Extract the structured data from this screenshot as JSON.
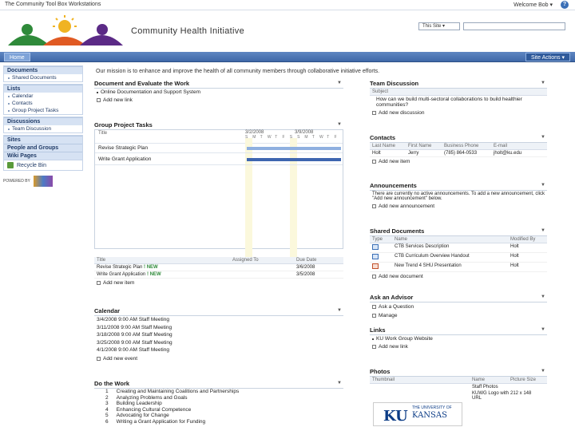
{
  "topbar": {
    "crumb": "The Community Tool Box Workstations",
    "welcome": "Welcome Bob ▾",
    "help": "?"
  },
  "header": {
    "site_title": "Community Health Initiative",
    "scope": "This Site ▾",
    "search_placeholder": ""
  },
  "nav": {
    "home": "Home",
    "site_actions": "Site Actions ▾"
  },
  "quicklaunch": {
    "documents": {
      "head": "Documents",
      "items": [
        "Shared Documents"
      ]
    },
    "lists": {
      "head": "Lists",
      "items": [
        "Calendar",
        "Contacts",
        "Group Project Tasks"
      ]
    },
    "discussions": {
      "head": "Discussions",
      "items": [
        "Team Discussion"
      ]
    },
    "sites": {
      "head": "Sites"
    },
    "people": {
      "head": "People and Groups"
    },
    "wiki": {
      "head": "Wiki Pages"
    },
    "recycle": "Recycle Bin",
    "badge_text": "POWERED BY"
  },
  "mission": "Our mission is to enhance and improve the health of all community members through collaborative initiative efforts.",
  "doc_eval": {
    "title": "Document and Evaluate the Work",
    "items": [
      "Online Documentation and Support System"
    ],
    "add": "Add new link"
  },
  "tasks": {
    "title": "Group Project Tasks",
    "title_col": "Title",
    "date1": "3/2/2008",
    "date2": "3/9/2008",
    "days": [
      "S",
      "M",
      "T",
      "W",
      "T",
      "F",
      "S",
      "S",
      "M",
      "T",
      "W",
      "T",
      "F"
    ],
    "rows": [
      "Revise Strategic Plan",
      "Write Grant Application"
    ],
    "table_headers": [
      "Title",
      "Assigned To",
      "Due Date"
    ],
    "table_rows": [
      {
        "title": "Revise Strategic Plan",
        "badge": "! NEW",
        "due": "3/6/2008"
      },
      {
        "title": "Write Grant Application",
        "badge": "! NEW",
        "due": "3/5/2008"
      }
    ],
    "add": "Add new item"
  },
  "calendar": {
    "title": "Calendar",
    "rows": [
      "3/4/2008 9:00 AM Staff Meeting",
      "3/11/2008 9:00 AM Staff Meeting",
      "3/18/2008 9:00 AM Staff Meeting",
      "3/25/2008 9:00 AM Staff Meeting",
      "4/1/2008 9:00 AM Staff Meeting"
    ],
    "add": "Add new event"
  },
  "on_work": {
    "title": "Do the Work",
    "rows": [
      {
        "n": "1",
        "t": "Creating and Maintaining Coalitions and Partnerships"
      },
      {
        "n": "2",
        "t": "Analyzing Problems and Goals"
      },
      {
        "n": "3",
        "t": "Building Leadership"
      },
      {
        "n": "4",
        "t": "Enhancing Cultural Competence"
      },
      {
        "n": "5",
        "t": "Advocating for Change"
      },
      {
        "n": "6",
        "t": "Writing a Grant Application for Funding"
      }
    ]
  },
  "team_disc": {
    "title": "Team Discussion",
    "subject_label": "Subject",
    "items": [
      "How can we build multi-sectoral collaborations to build healthier communities?"
    ],
    "add": "Add new discussion"
  },
  "contacts": {
    "title": "Contacts",
    "headers": [
      "Last Name",
      "First Name",
      "Business Phone",
      "E-mail"
    ],
    "rows": [
      [
        "Holt",
        "Jerry",
        "(785) 864-0533",
        "jholt@ku.edu"
      ]
    ],
    "add": "Add new item"
  },
  "announcements": {
    "title": "Announcements",
    "body": "There are currently no active announcements. To add a new announcement, click \"Add new announcement\" below.",
    "add": "Add new announcement"
  },
  "shared_docs": {
    "title": "Shared Documents",
    "headers": [
      "Type",
      "Name",
      "Modified By"
    ],
    "rows": [
      [
        "CTB Services Description",
        "Holt"
      ],
      [
        "CTB Curriculum Overview Handout",
        "Holt"
      ],
      [
        "New Trend 4 SHU Presentation",
        "Holt"
      ]
    ],
    "add": "Add new document"
  },
  "advisor": {
    "title": "Ask an Advisor",
    "items": [
      "Ask a Question",
      "Manage"
    ]
  },
  "links": {
    "title": "Links",
    "items": [
      "KU Work Group Website"
    ],
    "add": "Add new link"
  },
  "photos": {
    "title": "Photos",
    "headers": [
      "Thumbnail",
      "Name",
      "Picture Size"
    ],
    "rows": [
      [
        "Staff Photos",
        ""
      ],
      [
        "KUWG Logo with URL",
        "212 x 148"
      ]
    ]
  },
  "ku": {
    "uni": "THE UNIVERSITY OF",
    "ku": "KU",
    "kansas": "KANSAS"
  }
}
